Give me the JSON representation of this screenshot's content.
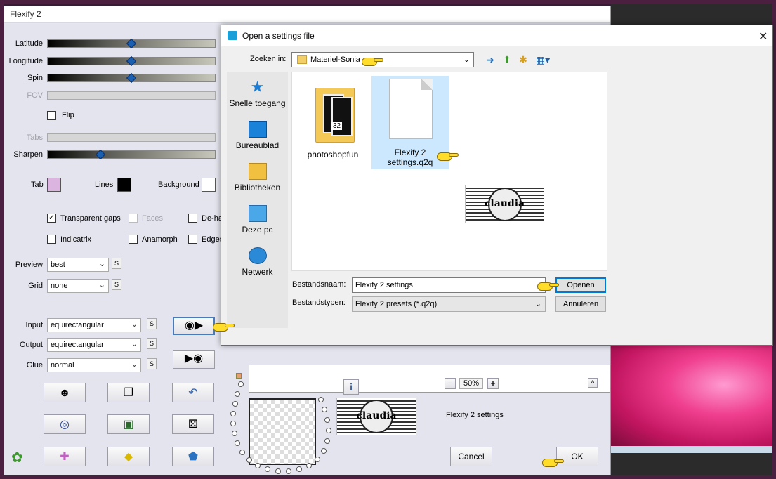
{
  "flexify": {
    "title": "Flexify 2",
    "sliders": {
      "latitude": "Latitude",
      "longitude": "Longitude",
      "spin": "Spin",
      "fov": "FOV",
      "tabs": "Tabs",
      "sharpen": "Sharpen"
    },
    "flip_label": "Flip",
    "colors": {
      "tab": "Tab",
      "lines": "Lines",
      "background": "Background",
      "tab_hex": "#dcb4e0",
      "lines_hex": "#000000",
      "background_hex": "#ffffff"
    },
    "options": {
      "transparent_gaps": "Transparent gaps",
      "faces": "Faces",
      "de_ha": "De-ha",
      "indicatrix": "Indicatrix",
      "anamorph": "Anamorph",
      "edges": "Edges"
    },
    "preview": {
      "label": "Preview",
      "value": "best"
    },
    "grid": {
      "label": "Grid",
      "value": "none"
    },
    "input": {
      "label": "Input",
      "value": "equirectangular"
    },
    "output": {
      "label": "Output",
      "value": "equirectangular"
    },
    "glue": {
      "label": "Glue",
      "value": "normal"
    },
    "s_label": "S",
    "zoom": {
      "minus": "−",
      "value": "50%",
      "plus": "+"
    },
    "up_label": "˄",
    "info_label": "i",
    "settings_name": "Flexify 2 settings",
    "cancel": "Cancel",
    "ok": "OK"
  },
  "dialog": {
    "title": "Open a settings file",
    "close": "✕",
    "zoeken_label": "Zoeken in:",
    "zoeken_value": "Materiel-Sonia",
    "places": [
      "Snelle toegang",
      "Bureaublad",
      "Bibliotheken",
      "Deze pc",
      "Netwerk"
    ],
    "files": [
      {
        "name": "photoshopfun",
        "type": "folder"
      },
      {
        "name": "Flexify 2 settings.q2q",
        "name_line1": "Flexify 2",
        "name_line2": "settings.q2q",
        "type": "file",
        "selected": true
      }
    ],
    "filename_label": "Bestandsnaam:",
    "filename_value": "Flexify 2 settings",
    "filetype_label": "Bestandstypen:",
    "filetype_value": "Flexify 2 presets (*.q2q)",
    "open_btn": "Openen",
    "cancel_btn": "Annuleren"
  },
  "watermark": "claudia",
  "folder_badge": "32",
  "icons": [
    "camera-icon",
    "back-icon",
    "up-folder-icon",
    "new-folder-icon",
    "view-menu-icon",
    "star-icon",
    "desktop-icon",
    "library-icon",
    "computer-icon",
    "network-icon",
    "hand-pointer-icon"
  ]
}
